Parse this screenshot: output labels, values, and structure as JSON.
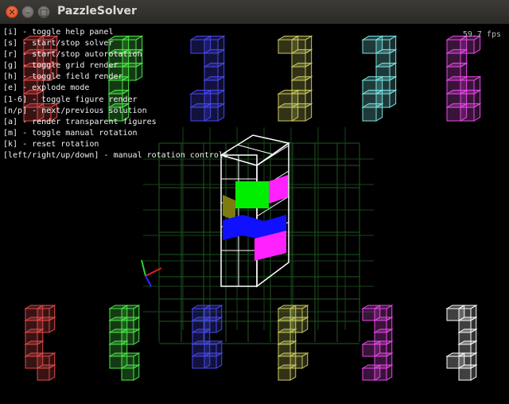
{
  "window": {
    "title": "PazzleSolver",
    "close_glyph": "✕",
    "minimize_glyph": "–",
    "maximize_glyph": "□"
  },
  "hud": {
    "fps": "59.7 fps",
    "help_lines": [
      "[i] - toggle help panel",
      "[s] - start/stop solver",
      "[r] - start/stop autorotation",
      "[g] - toggle grid render",
      "[h] - toggle field render",
      "[e] - explode mode",
      "[1-6] - toggle figure render",
      "[n/p] - next/previous solution",
      "[a] - render transparent figures",
      "[m] - toggle manual rotation",
      "[k] - reset rotation",
      "[left/right/up/down] - manual rotation controls"
    ]
  },
  "colors": {
    "red": "#e04a4a",
    "green": "#4ee84a",
    "blue": "#4848f0",
    "olive": "#c8c860",
    "cyan": "#7ce4e4",
    "magenta": "#e84ae8",
    "white": "#ffffff",
    "grid": "#1f5a1f",
    "face_green": "#00ee00",
    "face_blue": "#1010ff",
    "face_magenta": "#ff22ff",
    "face_olive": "#7c7c10"
  },
  "top_figures": [
    {
      "name": "figure-1-red",
      "color": "red"
    },
    {
      "name": "figure-2-green",
      "color": "green"
    },
    {
      "name": "figure-3-blue",
      "color": "blue"
    },
    {
      "name": "figure-4-olive",
      "color": "olive"
    },
    {
      "name": "figure-5-cyan",
      "color": "cyan"
    },
    {
      "name": "figure-6-magenta",
      "color": "magenta"
    }
  ],
  "bottom_figures": [
    {
      "name": "solution-figure-1-red",
      "color": "red"
    },
    {
      "name": "solution-figure-2-green",
      "color": "green"
    },
    {
      "name": "solution-figure-3-blue",
      "color": "blue"
    },
    {
      "name": "solution-figure-4-olive",
      "color": "olive"
    },
    {
      "name": "solution-figure-5-magenta",
      "color": "magenta"
    },
    {
      "name": "solution-figure-6-white",
      "color": "white"
    }
  ],
  "axes_icon": "xyz-axes-icon"
}
